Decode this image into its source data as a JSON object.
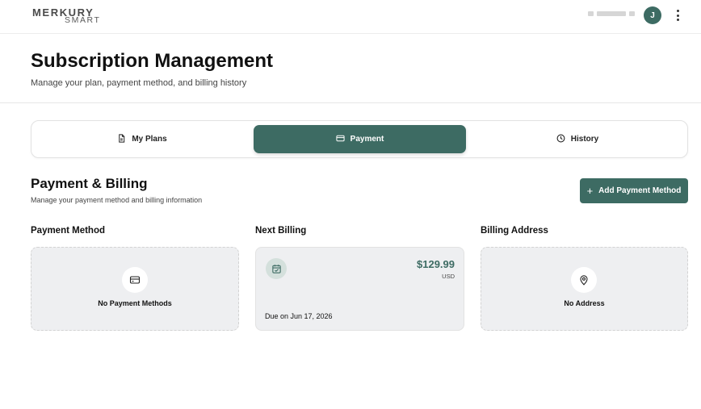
{
  "header": {
    "logo_top": "MERKURY",
    "logo_bottom": "SMART",
    "avatar_initial": "J"
  },
  "page": {
    "title": "Subscription Management",
    "subtitle": "Manage your plan, payment method, and billing history"
  },
  "tabs": [
    {
      "label": "My Plans",
      "icon": "document-icon",
      "active": false
    },
    {
      "label": "Payment",
      "icon": "credit-card-icon",
      "active": true
    },
    {
      "label": "History",
      "icon": "clock-icon",
      "active": false
    }
  ],
  "section": {
    "title": "Payment & Billing",
    "subtitle": "Manage your payment method and billing information",
    "add_button_label": "Add Payment Method"
  },
  "columns": {
    "payment_method": {
      "label": "Payment Method",
      "empty_text": "No Payment Methods",
      "icon": "credit-card-icon"
    },
    "next_billing": {
      "label": "Next Billing",
      "amount": "$129.99",
      "currency": "USD",
      "due": "Due on Jun 17, 2026",
      "icon": "calendar-check-icon"
    },
    "billing_address": {
      "label": "Billing Address",
      "empty_text": "No Address",
      "icon": "map-pin-icon"
    }
  },
  "colors": {
    "accent": "#3d6b63",
    "card_bg": "#eeeff1",
    "icon_badge_bg": "#d4e0dc"
  }
}
